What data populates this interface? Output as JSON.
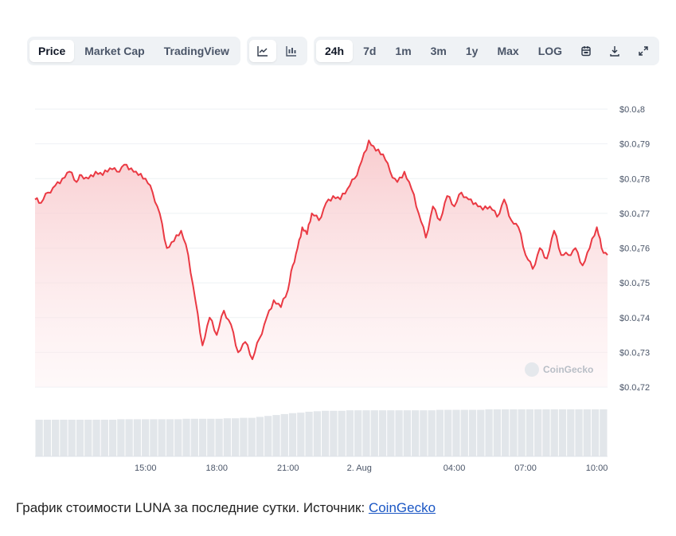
{
  "toolbar": {
    "metric_tabs": [
      "Price",
      "Market Cap",
      "TradingView"
    ],
    "active_metric": "Price",
    "chart_type_icons": [
      "line-chart-icon",
      "candlestick-chart-icon"
    ],
    "range_tabs": [
      "24h",
      "7d",
      "1m",
      "3m",
      "1y",
      "Max",
      "LOG"
    ],
    "active_range": "24h",
    "action_icons": [
      "calendar-icon",
      "download-icon",
      "expand-icon"
    ]
  },
  "watermark": "CoinGecko",
  "caption": {
    "text": "График стоимости LUNA за последние сутки. Источник: ",
    "link": "CoinGecko"
  },
  "colors": {
    "line": "#ea3943",
    "fill_top": "#f8c9cc",
    "volume": "#e2e6ea",
    "grid": "#eef1f4"
  },
  "chart_data": {
    "type": "area",
    "x_ticks": [
      "15:00",
      "18:00",
      "21:00",
      "2. Aug",
      "04:00",
      "07:00",
      "10:00"
    ],
    "x_tick_hours": [
      15,
      18,
      21,
      24,
      28,
      31,
      34
    ],
    "x_range": [
      10.35,
      34.45
    ],
    "y_ticks": [
      "$0.0₄8",
      "$0.0₄79",
      "$0.0₄78",
      "$0.0₄77",
      "$0.0₄76",
      "$0.0₄75",
      "$0.0₄74",
      "$0.0₄73",
      "$0.0₄72"
    ],
    "y_tick_values": [
      4.8e-05,
      4.79e-05,
      4.78e-05,
      4.77e-05,
      4.76e-05,
      4.75e-05,
      4.74e-05,
      4.73e-05,
      4.72e-05
    ],
    "ylim": [
      4.72e-05,
      4.8e-05
    ],
    "y_scale": "linear",
    "grid": true,
    "series": [
      {
        "values_x_hours": [
          10.35,
          10.6,
          10.9,
          11.2,
          11.5,
          11.8,
          12.1,
          12.3,
          12.6,
          12.9,
          13.2,
          13.5,
          13.8,
          14.1,
          14.4,
          14.7,
          15.0,
          15.3,
          15.6,
          15.9,
          16.2,
          16.5,
          16.8,
          17.1,
          17.4,
          17.7,
          18.0,
          18.3,
          18.6,
          18.9,
          19.2,
          19.5,
          19.8,
          20.1,
          20.4,
          20.7,
          21.0,
          21.2,
          21.4,
          21.6,
          21.8,
          22.0,
          22.3,
          22.6,
          22.9,
          23.2,
          23.5,
          23.8,
          24.1,
          24.4,
          24.7,
          25.0,
          25.3,
          25.6,
          25.9,
          26.2,
          26.5,
          26.8,
          27.1,
          27.4,
          27.7,
          28.0,
          28.3,
          28.6,
          28.9,
          29.2,
          29.5,
          29.8,
          30.1,
          30.4,
          30.7,
          31.0,
          31.3,
          31.6,
          31.9,
          32.2,
          32.5,
          32.8,
          33.1,
          33.4,
          33.7,
          34.0,
          34.2,
          34.45
        ],
        "values": [
          4.774e-05,
          4.773e-05,
          4.776e-05,
          4.778e-05,
          4.78e-05,
          4.782e-05,
          4.779e-05,
          4.781e-05,
          4.78e-05,
          4.782e-05,
          4.781e-05,
          4.783e-05,
          4.782e-05,
          4.784e-05,
          4.783e-05,
          4.781e-05,
          4.78e-05,
          4.776e-05,
          4.77e-05,
          4.76e-05,
          4.762e-05,
          4.765e-05,
          4.758e-05,
          4.745e-05,
          4.732e-05,
          4.74e-05,
          4.735e-05,
          4.742e-05,
          4.738e-05,
          4.73e-05,
          4.733e-05,
          4.728e-05,
          4.734e-05,
          4.74e-05,
          4.745e-05,
          4.743e-05,
          4.748e-05,
          4.755e-05,
          4.76e-05,
          4.766e-05,
          4.764e-05,
          4.77e-05,
          4.768e-05,
          4.773e-05,
          4.775e-05,
          4.774e-05,
          4.777e-05,
          4.78e-05,
          4.785e-05,
          4.791e-05,
          4.788e-05,
          4.787e-05,
          4.782e-05,
          4.779e-05,
          4.782e-05,
          4.777e-05,
          4.77e-05,
          4.763e-05,
          4.772e-05,
          4.768e-05,
          4.775e-05,
          4.772e-05,
          4.776e-05,
          4.774e-05,
          4.773e-05,
          4.771e-05,
          4.772e-05,
          4.769e-05,
          4.774e-05,
          4.768e-05,
          4.766e-05,
          4.758e-05,
          4.754e-05,
          4.76e-05,
          4.757e-05,
          4.765e-05,
          4.758e-05,
          4.758e-05,
          4.76e-05,
          4.755e-05,
          4.76e-05,
          4.766e-05,
          4.76e-05,
          4.758e-05
        ]
      }
    ],
    "volume": {
      "values_relative": [
        0.78,
        0.78,
        0.78,
        0.78,
        0.78,
        0.78,
        0.78,
        0.78,
        0.78,
        0.78,
        0.79,
        0.79,
        0.79,
        0.79,
        0.79,
        0.79,
        0.79,
        0.79,
        0.8,
        0.8,
        0.8,
        0.8,
        0.8,
        0.81,
        0.81,
        0.82,
        0.82,
        0.84,
        0.86,
        0.88,
        0.9,
        0.92,
        0.93,
        0.95,
        0.96,
        0.97,
        0.97,
        0.97,
        0.98,
        0.98,
        0.98,
        0.98,
        0.98,
        0.98,
        0.98,
        0.98,
        0.98,
        0.98,
        0.98,
        0.99,
        0.99,
        0.99,
        0.99,
        0.99,
        0.99,
        1.0,
        1.0,
        1.0,
        1.0,
        1.0,
        1.0,
        1.0,
        1.0,
        1.0,
        1.0,
        1.0,
        1.0,
        1.0,
        1.0,
        1.0
      ]
    }
  }
}
